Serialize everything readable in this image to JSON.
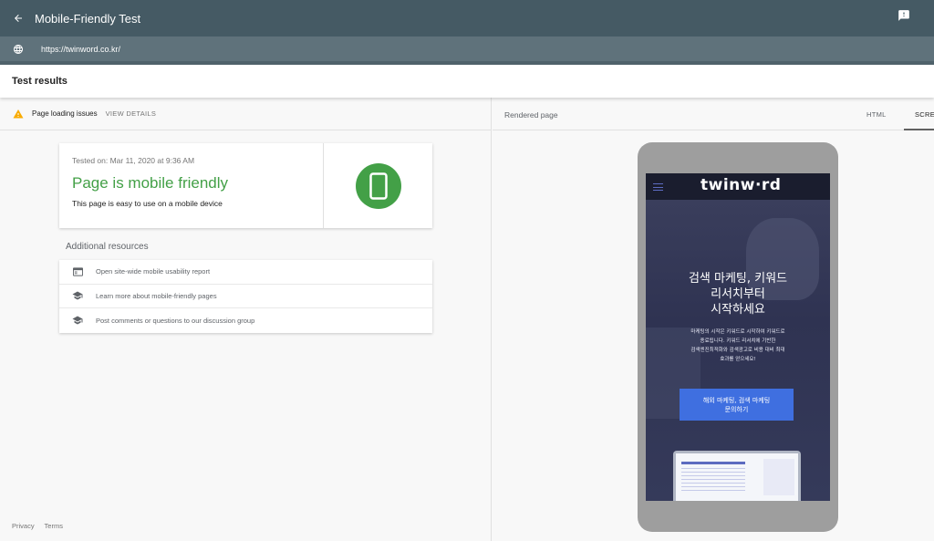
{
  "app": {
    "title": "Mobile-Friendly Test",
    "back_icon": "arrow-back-icon",
    "feedback_icon": "feedback-icon"
  },
  "url_bar": {
    "icon": "globe-icon",
    "url": "https://twinword.co.kr/"
  },
  "results": {
    "header": "Test results",
    "issues_label": "Page loading issues",
    "view_details": "VIEW DETAILS",
    "card": {
      "tested_on": "Tested on: Mar 11, 2020 at 9:36 AM",
      "headline": "Page is mobile friendly",
      "subtext": "This page is easy to use on a mobile device",
      "status_color": "#43a047"
    },
    "additional_title": "Additional resources",
    "resources": [
      {
        "icon": "report-icon",
        "label": "Open site-wide mobile usability report"
      },
      {
        "icon": "school-icon",
        "label": "Learn more about mobile-friendly pages"
      },
      {
        "icon": "school-icon",
        "label": "Post comments or questions to our discussion group"
      }
    ],
    "footer": {
      "privacy": "Privacy",
      "terms": "Terms"
    }
  },
  "rendered": {
    "label": "Rendered page",
    "tabs": [
      {
        "label": "HTML",
        "active": false
      },
      {
        "label": "SCREENSHOT",
        "active": true
      }
    ],
    "site": {
      "logo": "twinw·rd",
      "headline": "검색 마케팅, 키워드\n리서치부터\n시작하세요",
      "description": "마케팅의 시작은 키워드로 시작하여 키워드로\n종료됩니다. 키워드 리서치에 기반한\n검색엔진최적화와 검색광고로 비용 대비 최대\n효과를 얻으세요!",
      "cta": "해외 마케팅, 검색 마케팅\n문의하기"
    }
  }
}
